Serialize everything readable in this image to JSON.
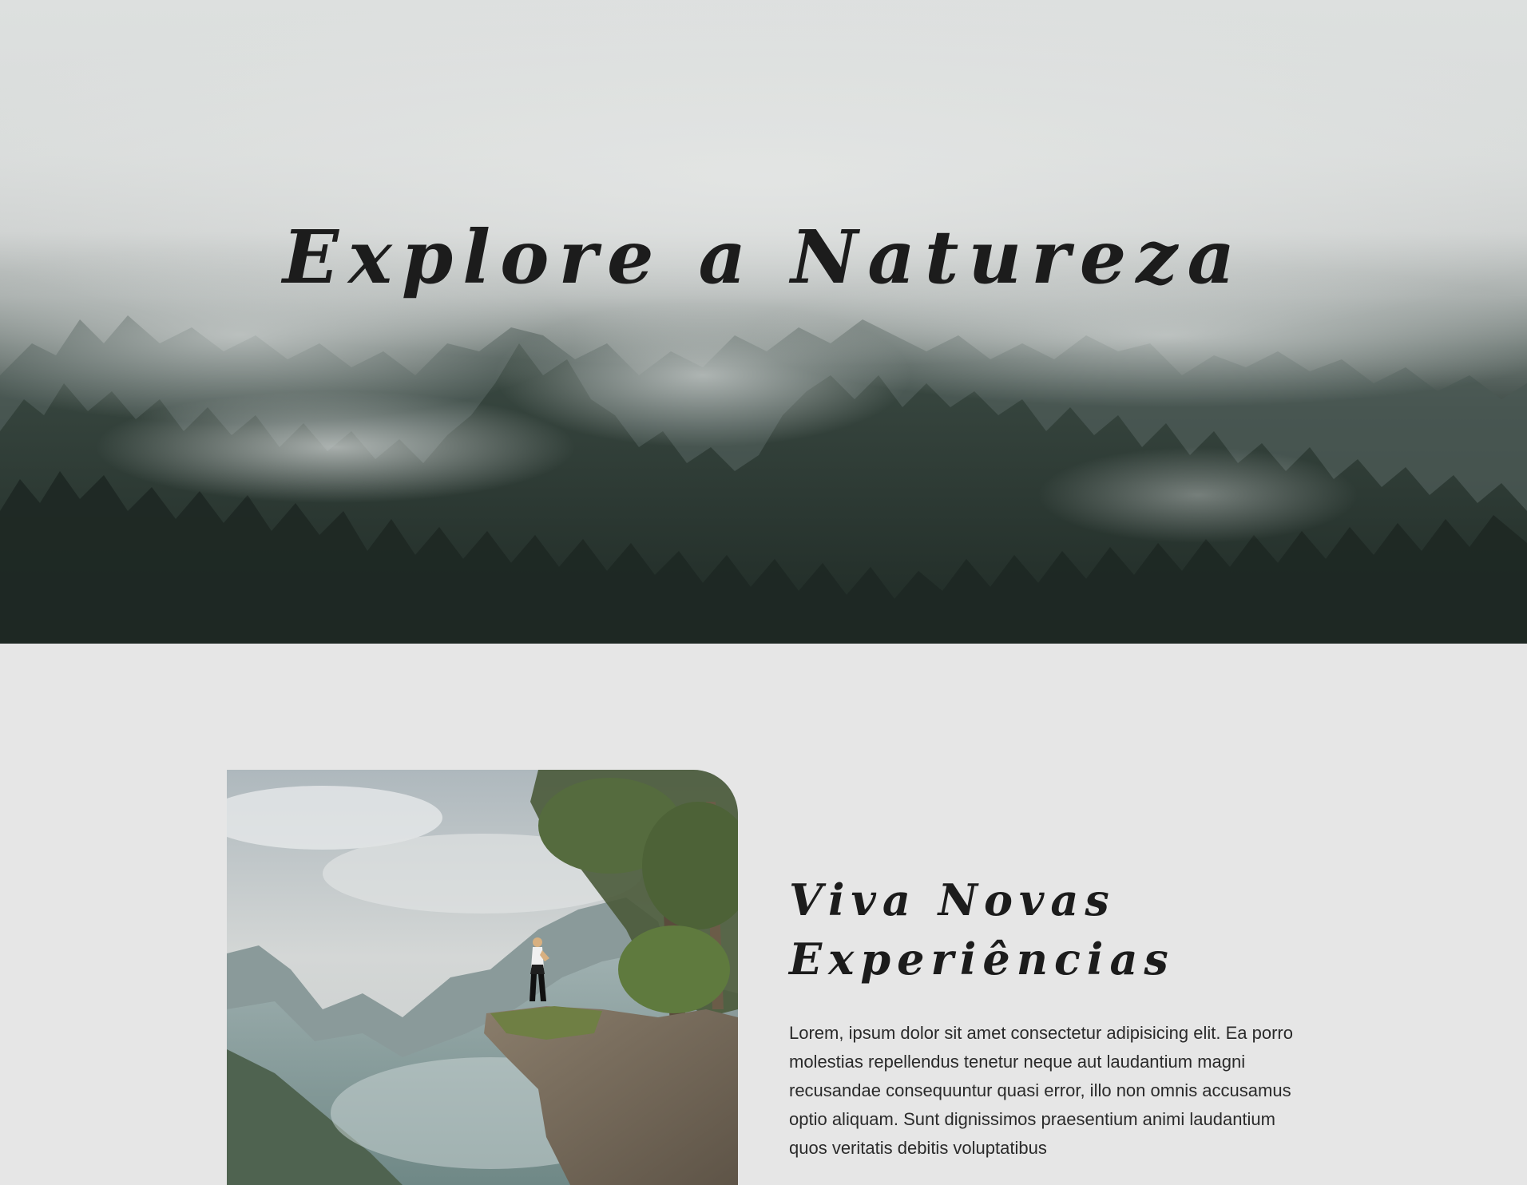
{
  "hero": {
    "title": "Explore a Natureza",
    "image": "misty-forest-image"
  },
  "feature": {
    "image": "hiker-on-cliff-image",
    "title": "Viva Novas Experiências",
    "text": "Lorem, ipsum dolor sit amet consectetur adipisicing elit. Ea porro molestias repellendus tenetur neque aut laudantium magni recusandae consequuntur quasi error, illo non omnis accusamus optio aliquam. Sunt dignissimos praesentium animi laudantium quos veritatis debitis voluptatibus"
  },
  "colors": {
    "background": "#e6e6e6",
    "text": "#1c1c1c",
    "forest": "#26322d",
    "mist": "#dde0df"
  }
}
